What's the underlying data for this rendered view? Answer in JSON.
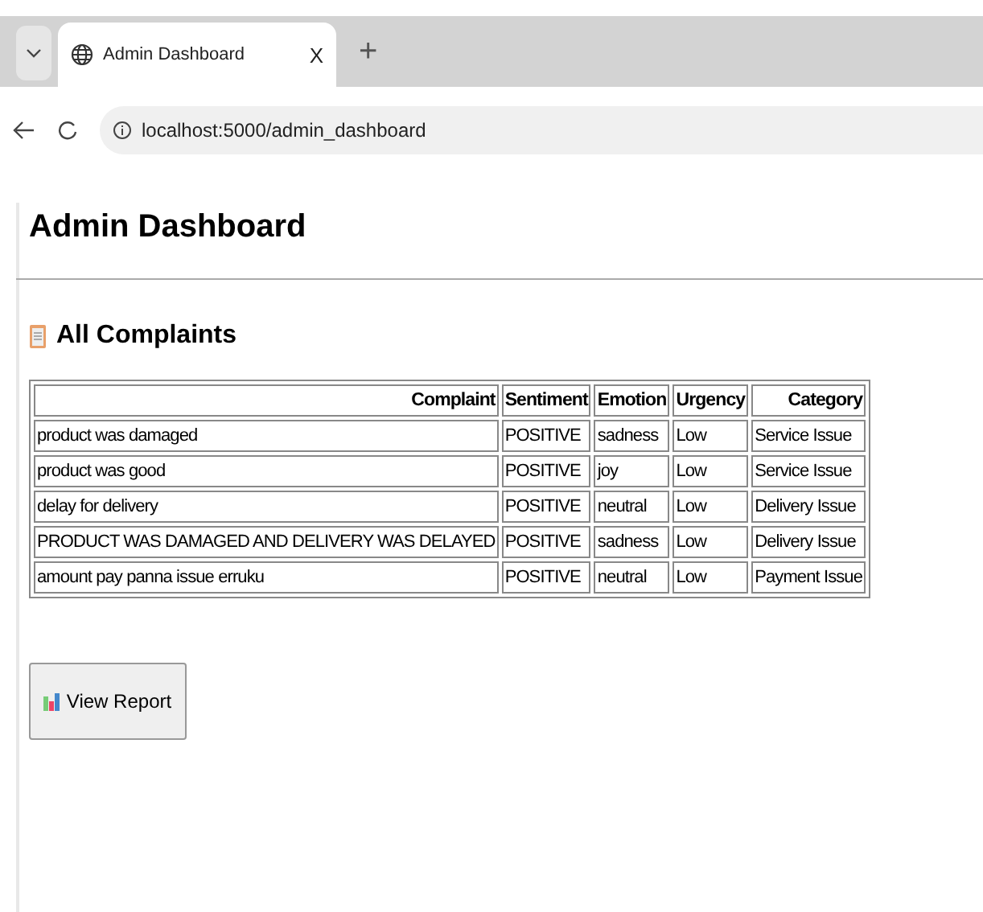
{
  "browser": {
    "tab_title": "Admin Dashboard",
    "close": "X",
    "new_tab": "+",
    "url": "localhost:5000/admin_dashboard"
  },
  "page": {
    "title": "Admin Dashboard",
    "section_title": "All Complaints",
    "table": {
      "columns": [
        "Complaint",
        "Sentiment",
        "Emotion",
        "Urgency",
        "Category"
      ],
      "rows": [
        [
          "product was damaged",
          "POSITIVE",
          "sadness",
          "Low",
          "Service Issue"
        ],
        [
          "product was good",
          "POSITIVE",
          "joy",
          "Low",
          "Service Issue"
        ],
        [
          "delay for delivery",
          "POSITIVE",
          "neutral",
          "Low",
          "Delivery Issue"
        ],
        [
          "PRODUCT WAS DAMAGED AND DELIVERY WAS DELAYED",
          "POSITIVE",
          "sadness",
          "Low",
          "Delivery Issue"
        ],
        [
          "amount pay panna issue erruku",
          "POSITIVE",
          "neutral",
          "Low",
          "Payment Issue"
        ]
      ]
    },
    "button": "View Report"
  }
}
